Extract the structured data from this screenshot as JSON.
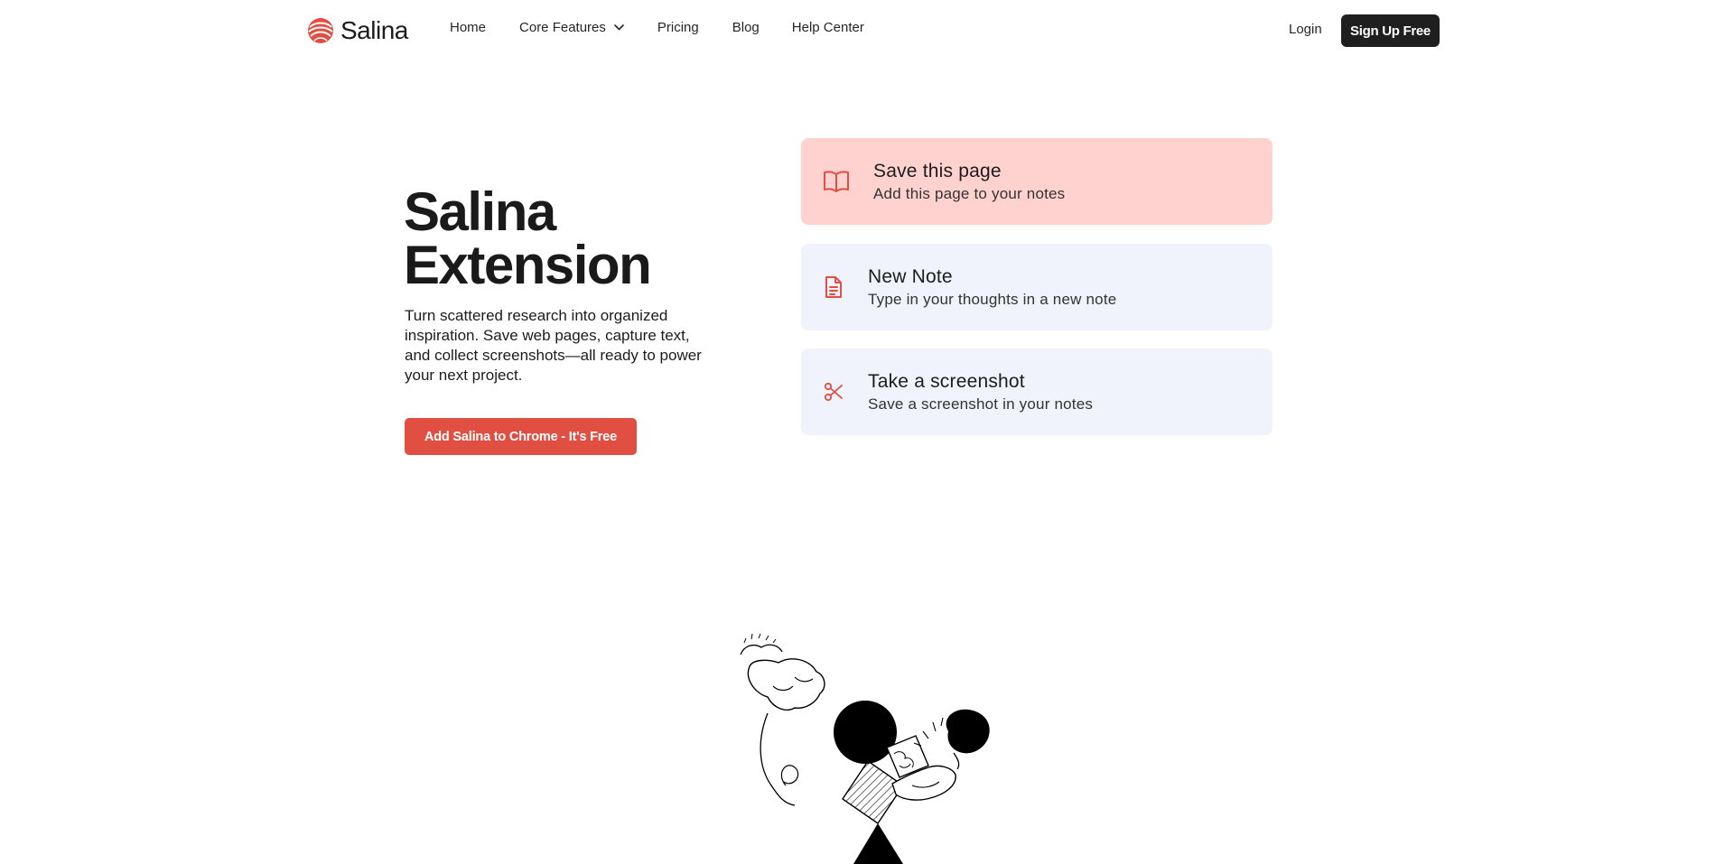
{
  "brand": {
    "name": "Salina",
    "accent": "#e04f42"
  },
  "nav": {
    "links": [
      {
        "label": "Home"
      },
      {
        "label": "Core Features",
        "has_dropdown": true
      },
      {
        "label": "Pricing"
      },
      {
        "label": "Blog"
      },
      {
        "label": "Help Center"
      }
    ],
    "login_label": "Login",
    "signup_label": "Sign Up Free"
  },
  "hero": {
    "title_line1": "Salina",
    "title_line2": "Extension",
    "description": "Turn scattered research into organized inspiration. Save web pages, capture text, and collect screenshots—all ready to power your next project.",
    "cta_label": "Add Salina to Chrome - It's Free"
  },
  "actions": [
    {
      "title": "Save this page",
      "subtitle": "Add this page to your notes",
      "icon": "book-open-icon",
      "active": true
    },
    {
      "title": "New Note",
      "subtitle": "Type in your thoughts in a new note",
      "icon": "document-icon",
      "active": false
    },
    {
      "title": "Take a screenshot",
      "subtitle": "Save a screenshot in your notes",
      "icon": "scissors-icon",
      "active": false
    }
  ],
  "colors": {
    "active_card": "#ffd1cf",
    "card": "#f0f3fc",
    "dark_button": "#1f1f1f"
  }
}
